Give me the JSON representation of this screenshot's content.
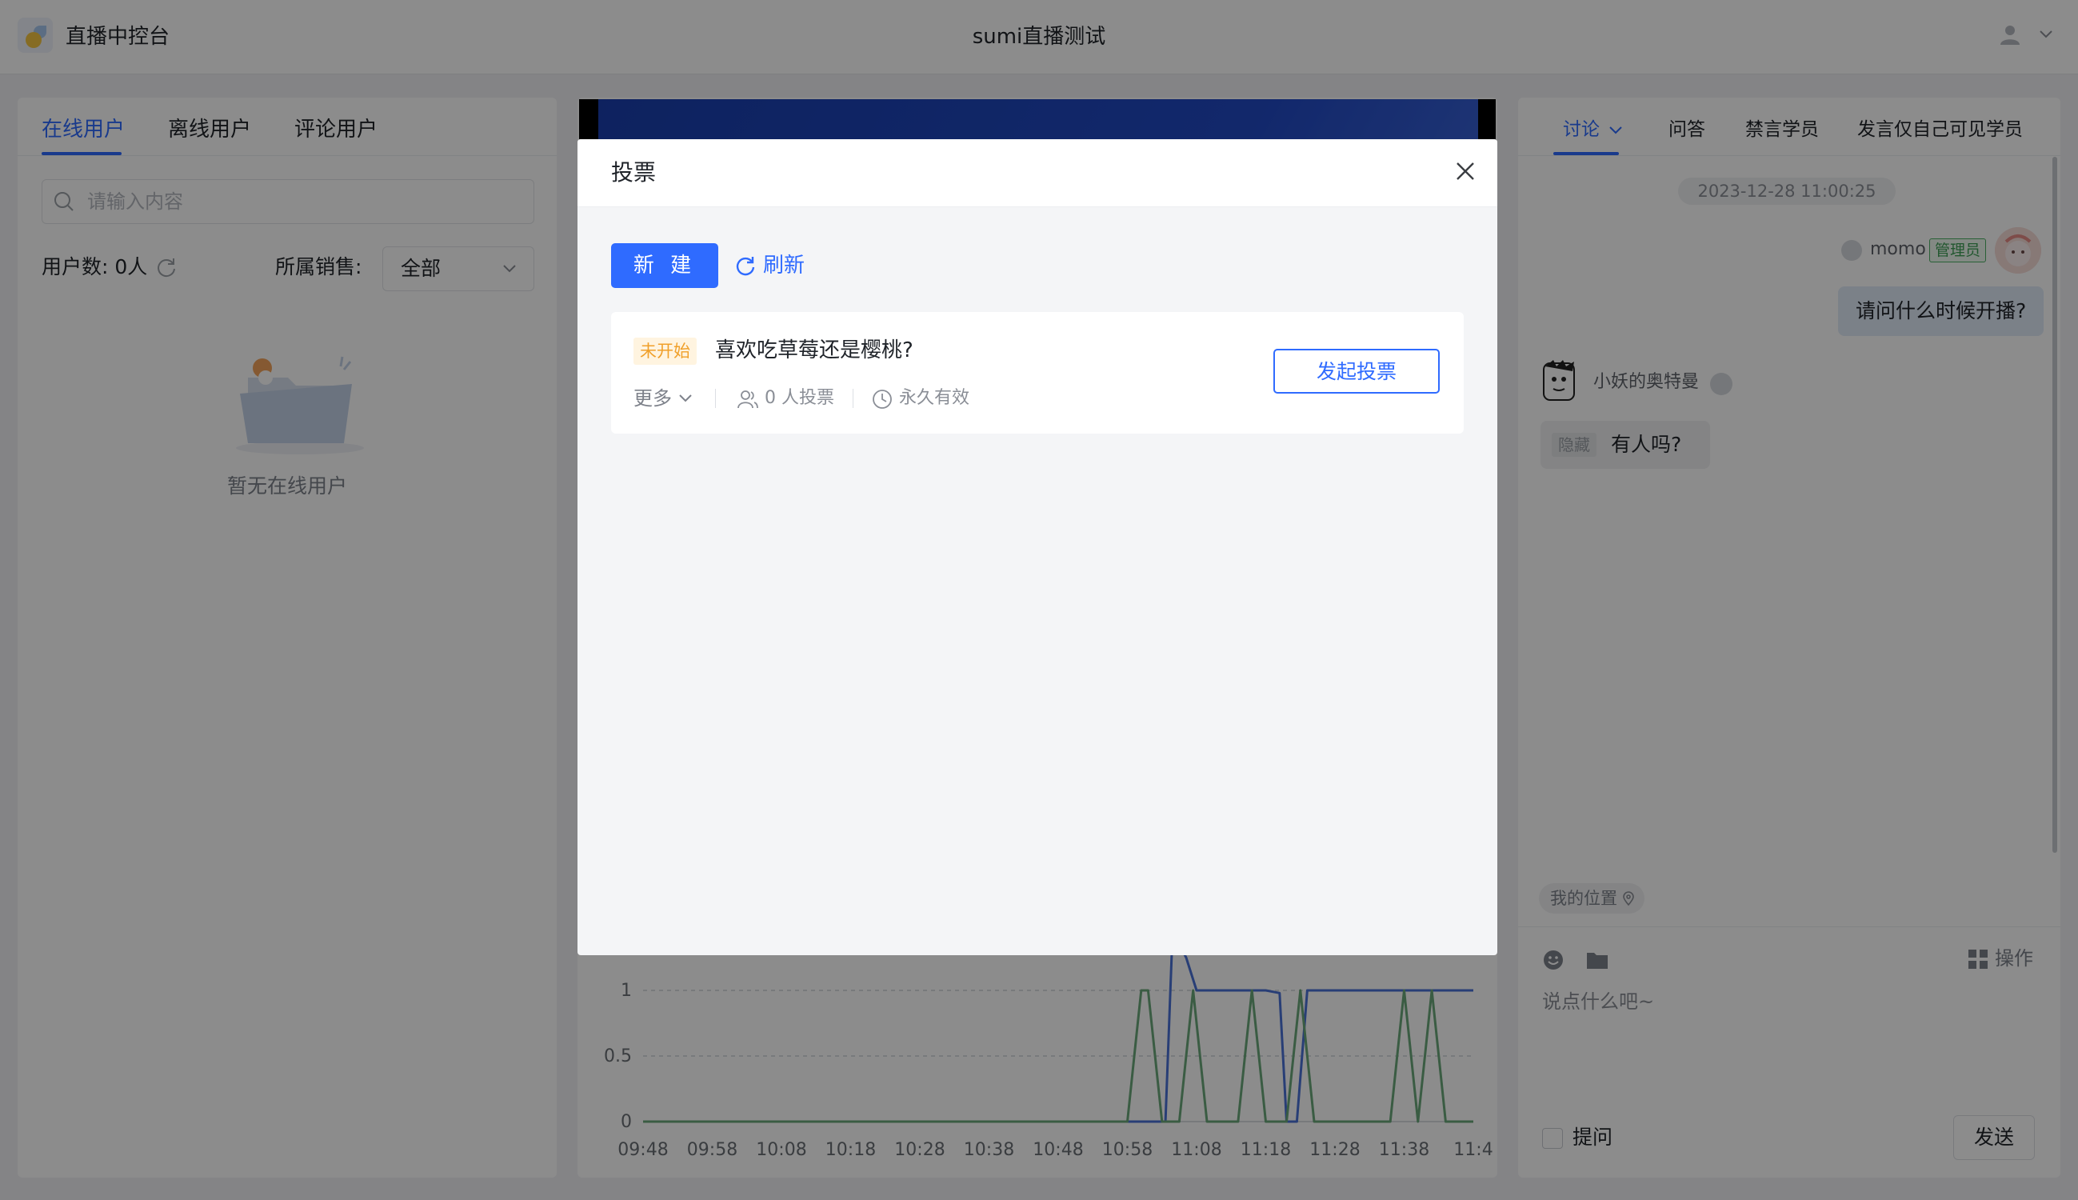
{
  "header": {
    "app_title": "直播中控台",
    "room_title": "sumi直播测试"
  },
  "left_panel": {
    "tabs": [
      "在线用户",
      "离线用户",
      "评论用户"
    ],
    "search_placeholder": "请输入内容",
    "user_count": "用户数: 0人",
    "sales_label": "所属销售:",
    "sales_selected": "全部",
    "empty_text": "暂无在线用户"
  },
  "right_panel": {
    "tabs": [
      "讨论",
      "问答",
      "禁言学员",
      "发言仅自己可见学员"
    ],
    "timestamp": "2023-12-28 11:00:25",
    "messages": [
      {
        "sender": "momo",
        "badge": "管理员",
        "text": "请问什么时候开播?"
      },
      {
        "sender": "小妖的奥特曼",
        "tag": "隐藏",
        "text": "有人吗?"
      }
    ],
    "location_chip": "我的位置",
    "operations_label": "操作",
    "input_placeholder": "说点什么吧~",
    "ask_label": "提问",
    "send_label": "发送"
  },
  "modal": {
    "title": "投票",
    "new_button": "新 建",
    "refresh_button": "刷新",
    "votes": [
      {
        "status": "未开始",
        "title": "喜欢吃草莓还是樱桃?",
        "more": "更多",
        "voters": "0 人投票",
        "validity": "永久有效",
        "action": "发起投票"
      }
    ]
  },
  "chart_data": {
    "type": "line",
    "y_ticks": [
      "0",
      "0.5",
      "1"
    ],
    "x_ticks": [
      "09:48",
      "09:58",
      "10:08",
      "10:18",
      "10:28",
      "10:38",
      "10:48",
      "10:58",
      "11:08",
      "11:18",
      "11:28",
      "11:38",
      "11:4"
    ],
    "ylim": [
      0,
      1
    ],
    "grid": true,
    "series": [
      {
        "color": "#4a72d8",
        "x": [
          0,
          7.4,
          7.55,
          7.65,
          7.7,
          7.85,
          8.0,
          8.2,
          9.0,
          9.2,
          9.3,
          9.45,
          9.6,
          9.8,
          12.0
        ],
        "y": [
          0,
          0,
          0,
          1.4,
          1.4,
          1.25,
          1.0,
          1.0,
          1.0,
          0.98,
          0.0,
          0.0,
          1.0,
          1.0,
          1.0
        ]
      },
      {
        "color": "#6aa87a",
        "x": [
          0,
          7.0,
          7.1,
          7.2,
          7.3,
          7.4,
          7.5,
          7.75,
          7.85,
          7.95,
          8.05,
          8.15,
          8.6,
          8.7,
          8.8,
          8.9,
          9.0,
          9.3,
          9.4,
          9.5,
          9.6,
          9.7,
          10.8,
          10.9,
          11.0,
          11.1,
          11.2,
          11.2,
          11.3,
          11.4,
          11.5,
          11.6,
          12.0
        ],
        "y": [
          0,
          0,
          0.5,
          1,
          1,
          0.5,
          0,
          0,
          0.5,
          1,
          0.5,
          0,
          0,
          0.5,
          1,
          0.5,
          0,
          0,
          0.5,
          1,
          0.5,
          0,
          0,
          0.5,
          1,
          0.5,
          0,
          0,
          0.5,
          1,
          0.5,
          0,
          0
        ]
      }
    ]
  }
}
